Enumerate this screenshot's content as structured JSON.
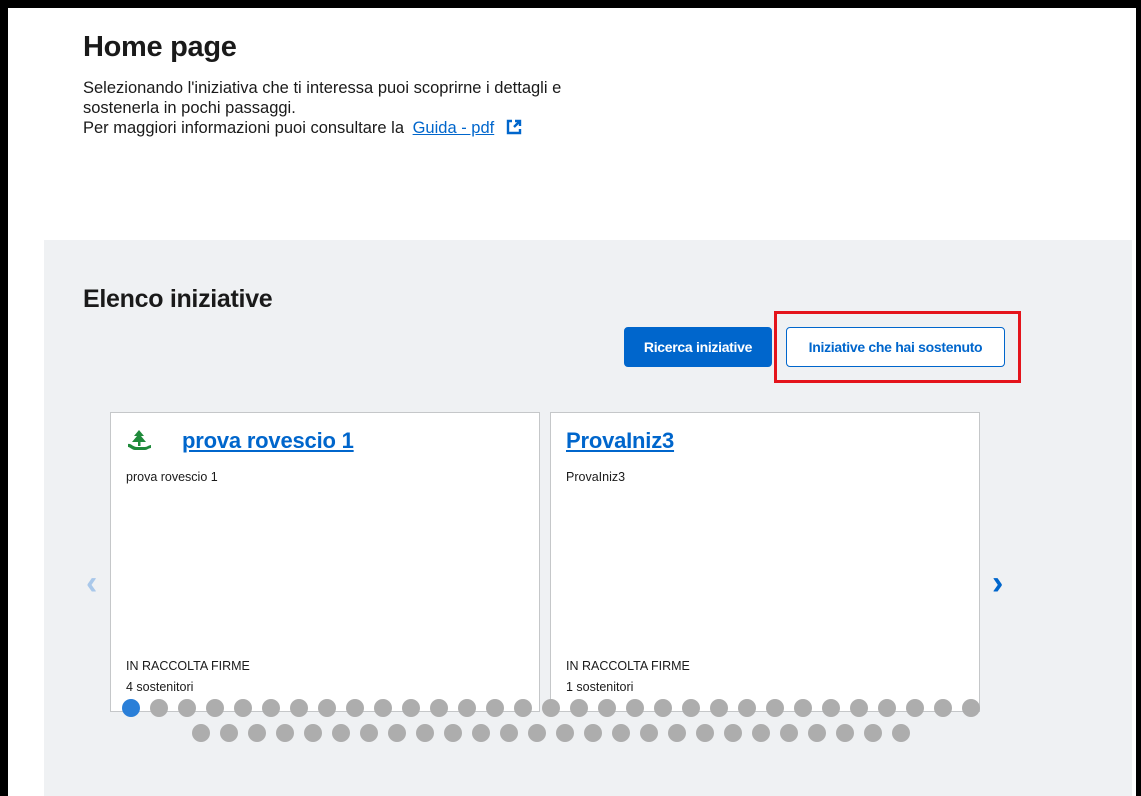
{
  "header": {
    "title": "Home page",
    "desc_line1": "Selezionando l'iniziativa che ti interessa puoi scoprirne i dettagli e",
    "desc_line2": "sostenerla in pochi passaggi.",
    "desc_line3": "Per maggiori informazioni puoi consultare la",
    "guide_link": "Guida - pdf",
    "guide_icon": "external-link-icon"
  },
  "list": {
    "title": "Elenco iniziative",
    "search_button": "Ricerca iniziative",
    "supported_button": "Iniziative che hai sostenuto"
  },
  "carousel": {
    "prev_arrow": "‹",
    "next_arrow": "›",
    "cards": [
      {
        "title": "prova rovescio 1",
        "description": "prova rovescio 1",
        "status": "IN RACCOLTA FIRME",
        "supporters": "4 sostenitori",
        "icon": "category-icon"
      },
      {
        "title": "ProvaIniz3",
        "description": "ProvaIniz3",
        "status": "IN RACCOLTA FIRME",
        "supporters": "1 sostenitori"
      }
    ],
    "dot_count": 57,
    "active_dot": 0
  },
  "colors": {
    "primary": "#0066cc",
    "highlight": "#e4141b",
    "section_bg": "#eff1f3",
    "icon_green": "#1f8a3b"
  }
}
